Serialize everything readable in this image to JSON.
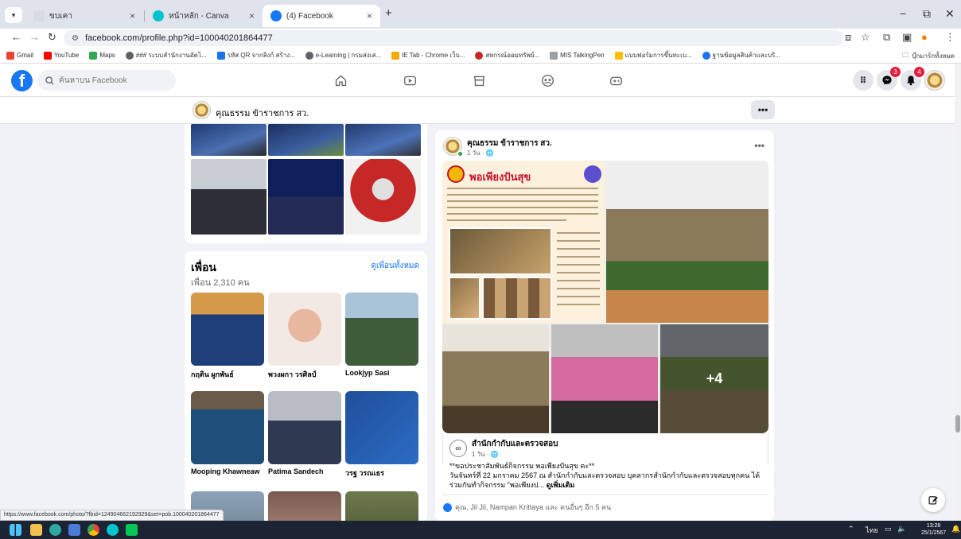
{
  "browser": {
    "tabs": [
      {
        "title": "ขบเคา",
        "active": false
      },
      {
        "title": "หน้าหลัก - Canva",
        "active": false
      },
      {
        "title": "(4) Facebook",
        "active": true
      }
    ],
    "url": "facebook.com/profile.php?id=100040201864477",
    "bookmarks": [
      "Gmail",
      "YouTube",
      "Maps",
      "### ระบบสำนักงานอัตโ...",
      "รหัส QR จากลิงก์ สร้าง...",
      "e-Learning | กรมส่งเส...",
      "IE Tab - Chrome เว็บ...",
      "สหกรณ์ออมทรัพย์...",
      "MIS TalkingPen",
      "แบบฟอร์มการขึ้นทะเบ...",
      "ฐานข้อมูลสินค้าและบริ..."
    ],
    "bookmarks_folder": "บุ๊กมาร์กทั้งหมด",
    "status_url": "https://www.facebook.com/photo/?fbid=124904662192929&set=pob.100040201864477"
  },
  "fb": {
    "search_placeholder": "ค้นหาบน Facebook",
    "messenger_badge": "3",
    "notif_badge": "4"
  },
  "profile": {
    "name": "คุณธรรม ข้าราชการ สว.",
    "more": "•••"
  },
  "friends": {
    "title": "เพื่อน",
    "count": "เพื่อน 2,310 คน",
    "see_all": "ดูเพื่อนทั้งหมด",
    "list": [
      {
        "name": "กฤติน ผูกพันธ์"
      },
      {
        "name": "พวงผกา วรศิลป์"
      },
      {
        "name": "Lookjyp Sasi"
      },
      {
        "name": "Mooping Khawneaw"
      },
      {
        "name": "Patima Sandech"
      },
      {
        "name": "วรฐ วรณเธร"
      }
    ]
  },
  "post": {
    "author": "คุณธรรม ข้าราชการ สว.",
    "meta": "1 วัน · 🌐",
    "more": "•••",
    "poster_title": "พอเพียงปันสุข",
    "more_photos": "+4",
    "shared_author": "สำนักกำกับและตรวจสอบ",
    "shared_meta": "1 วัน · 🌐",
    "text_line1": "**ขอประชาสัมพันธ์กิจกรรม พอเพียงปันสุข คะ**",
    "text_line2": "วันจันทร์ที่ 22 มกราคม 2567 ณ สำนักกำกับและตรวจสอบ บุคลากรสำนักกำกับและตรวจสอบทุกคน ได้",
    "text_line3": "ร่วมกันทำกิจกรรม \"พอเพียงป...",
    "see_more": "ดูเพิ่มเติม",
    "reactions": "คุณ, Jil Jil, Nampan Krittaya และ คนอื่นๆ อีก 5 คน"
  },
  "taskbar": {
    "lang": "ไทย",
    "time": "13:28",
    "date": "25/1/2567"
  }
}
